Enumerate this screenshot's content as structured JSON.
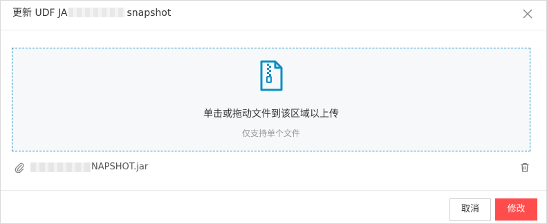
{
  "dialog": {
    "title_prefix": "更新 UDF JA",
    "title_suffix": "snapshot",
    "close_icon": "close-icon"
  },
  "dropzone": {
    "icon": "zip-file-icon",
    "main_text": "单击或拖动文件到该区域以上传",
    "sub_text": "仅支持单个文件",
    "accent_color": "#0a8fc3"
  },
  "file": {
    "icon": "paperclip-icon",
    "name_visible": "NAPSHOT.jar",
    "delete_icon": "trash-icon"
  },
  "footer": {
    "cancel_label": "取消",
    "submit_label": "修改",
    "submit_color": "#ff4d4d"
  }
}
